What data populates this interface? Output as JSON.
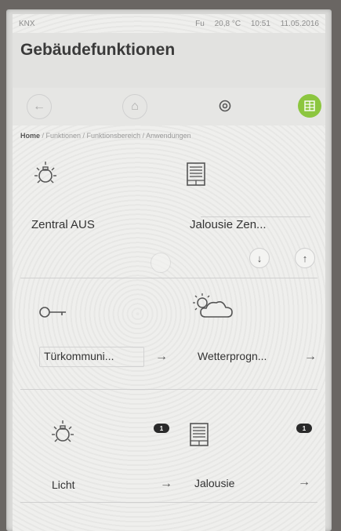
{
  "status": {
    "brand": "KNX",
    "indicator": "Fu",
    "temperature": "20,8 °C",
    "time": "10:51",
    "date": "11.05.2016"
  },
  "header": {
    "title": "Gebäudefunktionen"
  },
  "nav": {
    "back_icon": "←",
    "home_icon": "⌂",
    "settings_icon": "⚙",
    "grid_icon": "▦"
  },
  "breadcrumb": {
    "home": "Home",
    "rest": " / Funktionen / Funktionsbereich / Anwendungen"
  },
  "tiles": {
    "zentral_aus": {
      "label": "Zentral AUS"
    },
    "jalousie_zentral": {
      "label": "Jalousie Zen...",
      "down": "↓",
      "up": "↑"
    },
    "tuerkommunikation": {
      "label": "Türkommuni...",
      "arrow": "→"
    },
    "wetterprognose": {
      "label": "Wetterprogn...",
      "arrow": "→"
    },
    "licht": {
      "label": "Licht",
      "arrow": "→",
      "badge": "1"
    },
    "jalousie": {
      "label": "Jalousie",
      "arrow": "→",
      "badge": "1"
    }
  },
  "colors": {
    "accent": "#8cc63f",
    "background": "#efefed"
  }
}
